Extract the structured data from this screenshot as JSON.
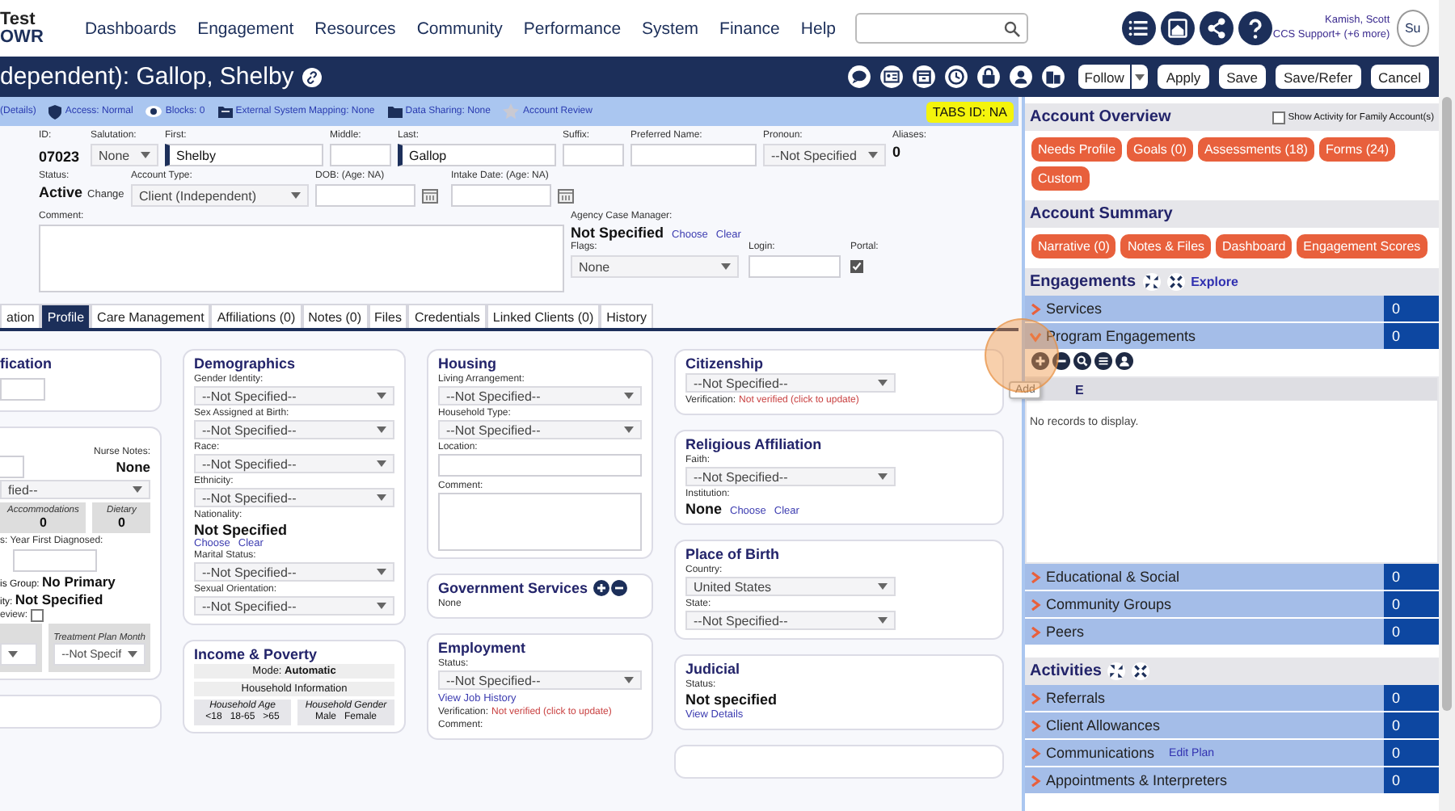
{
  "nav": {
    "logo_top": "Test",
    "logo_bottom": "OWR",
    "menu": [
      "Dashboards",
      "Engagement",
      "Resources",
      "Community",
      "Performance",
      "System",
      "Finance",
      "Help"
    ],
    "user": {
      "name": "Kamish, Scott",
      "role": "CCS Support+ (+6 more)",
      "avatar": "Su"
    }
  },
  "header": {
    "title": "dependent): Gallop, Shelby",
    "follow": "Follow",
    "buttons": [
      "Apply",
      "Save",
      "Save/Refer",
      "Cancel"
    ]
  },
  "info_bar": {
    "items": [
      "(Details)",
      "Access: Normal",
      "Blocks: 0",
      "External System Mapping: None",
      "Data Sharing: None",
      "Account Review"
    ],
    "tabs_id": "TABS ID: NA"
  },
  "client": {
    "id": {
      "label": "ID:",
      "value": "07023"
    },
    "salutation": {
      "label": "Salutation:",
      "value": "None"
    },
    "first": {
      "label": "First:",
      "value": "Shelby"
    },
    "middle": {
      "label": "Middle:"
    },
    "last": {
      "label": "Last:",
      "value": "Gallop"
    },
    "suffix": {
      "label": "Suffix:"
    },
    "preferred_name": {
      "label": "Preferred Name:"
    },
    "pronoun": {
      "label": "Pronoun:",
      "value": "--Not Specified"
    },
    "aliases": {
      "label": "Aliases:",
      "value": "0"
    },
    "status": {
      "label": "Status:",
      "value": "Active",
      "action": "Change"
    },
    "account_type": {
      "label": "Account Type:",
      "value": "Client (Independent)"
    },
    "dob": {
      "label": "DOB: (Age: NA)"
    },
    "intake_date": {
      "label": "Intake Date: (Age: NA)"
    },
    "comment": {
      "label": "Comment:"
    },
    "case_manager": {
      "label": "Agency Case Manager:",
      "value": "Not Specified",
      "links": [
        "Choose",
        "Clear"
      ]
    },
    "flags": {
      "label": "Flags:",
      "value": "None"
    },
    "login": {
      "label": "Login:"
    },
    "portal": {
      "label": "Portal:",
      "checked": true
    }
  },
  "tabs": [
    {
      "label": "ation",
      "selected": false
    },
    {
      "label": "Profile",
      "selected": true
    },
    {
      "label": "Care Management",
      "selected": false
    },
    {
      "label": "Affiliations (0)",
      "selected": false
    },
    {
      "label": "Notes (0)",
      "selected": false
    },
    {
      "label": "Files",
      "selected": false
    },
    {
      "label": "Credentials",
      "selected": false
    },
    {
      "label": "Linked Clients (0)",
      "selected": false
    },
    {
      "label": "History",
      "selected": false
    }
  ],
  "identification_card": {
    "title": "fication"
  },
  "health_card": {
    "nurse_label": "Nurse Notes:",
    "nurse_value": "None",
    "select": "fied--",
    "boxes": [
      {
        "title": "Accommodations",
        "value": "0"
      },
      {
        "title": "Dietary",
        "value": "0"
      }
    ],
    "diagnosed_label": "s:  Year First Diagnosed:",
    "group": "is Group: **No Primary**",
    "ethnicity": "ity: **Not Specified**",
    "review": {
      "label": "eview:",
      "checked": false
    },
    "plan": {
      "title": "Treatment Plan Month",
      "value": "--Not Specif"
    }
  },
  "columns": [
    [
      {
        "title": "Demographics",
        "rows": [
          {
            "kind": "label",
            "text": "Gender Identity:"
          },
          {
            "kind": "select",
            "value": "--Not Specified--"
          },
          {
            "kind": "label",
            "text": "Sex Assigned at Birth:"
          },
          {
            "kind": "select",
            "value": "--Not Specified--"
          },
          {
            "kind": "label",
            "text": "Race:"
          },
          {
            "kind": "select",
            "value": "--Not Specified--"
          },
          {
            "kind": "label",
            "text": "Ethnicity:"
          },
          {
            "kind": "select",
            "value": "--Not Specified--"
          },
          {
            "kind": "label",
            "text": "Nationality:"
          },
          {
            "kind": "value",
            "text": "Not Specified"
          },
          {
            "kind": "links",
            "items": [
              "Choose",
              "Clear"
            ]
          },
          {
            "kind": "label",
            "text": "Marital Status:"
          },
          {
            "kind": "select",
            "value": "--Not Specified--"
          },
          {
            "kind": "label",
            "text": "Sexual Orientation:"
          },
          {
            "kind": "select",
            "value": "--Not Specified--"
          }
        ]
      },
      {
        "title": "Income & Poverty",
        "rows": [
          {
            "kind": "band",
            "text": "Mode: **Automatic**"
          },
          {
            "kind": "band",
            "text": "Household Information"
          },
          {
            "kind": "household",
            "groups": [
              {
                "title": "Household Age",
                "cols": [
                  "<18",
                  "18-65",
                  ">65"
                ]
              },
              {
                "title": "Household Gender",
                "cols": [
                  "Male",
                  "Female"
                ]
              }
            ]
          }
        ]
      }
    ],
    [
      {
        "title": "Housing",
        "rows": [
          {
            "kind": "label",
            "text": "Living Arrangement:"
          },
          {
            "kind": "select",
            "value": "--Not Specified--"
          },
          {
            "kind": "label",
            "text": "Household Type:"
          },
          {
            "kind": "select",
            "value": "--Not Specified--"
          },
          {
            "kind": "label",
            "text": "Location:"
          },
          {
            "kind": "input"
          },
          {
            "kind": "label",
            "text": "Comment:"
          },
          {
            "kind": "textarea"
          }
        ]
      },
      {
        "title": "Government Services",
        "add_remove": true,
        "rows": [
          {
            "kind": "note",
            "text": "None"
          }
        ]
      },
      {
        "title": "Employment",
        "rows": [
          {
            "kind": "label",
            "text": "Status:"
          },
          {
            "kind": "select",
            "value": "--Not Specified--"
          },
          {
            "kind": "link",
            "text": "View Job History"
          },
          {
            "kind": "verification",
            "label": "Verification:",
            "text": "Not verified (click to update)"
          },
          {
            "kind": "label",
            "text": "Comment:"
          }
        ]
      }
    ],
    [
      {
        "title": "Citizenship",
        "rows": [
          {
            "kind": "select",
            "value": "--Not Specified--"
          },
          {
            "kind": "verification",
            "label": "Verification:",
            "text": "Not verified (click to update)"
          }
        ]
      },
      {
        "title": "Religious Affiliation",
        "rows": [
          {
            "kind": "label",
            "text": "Faith:"
          },
          {
            "kind": "select",
            "value": "--Not Specified--"
          },
          {
            "kind": "label",
            "text": "Institution:"
          },
          {
            "kind": "value_links",
            "text": "None",
            "items": [
              "Choose",
              "Clear"
            ]
          }
        ]
      },
      {
        "title": "Place of Birth",
        "rows": [
          {
            "kind": "label",
            "text": "Country:"
          },
          {
            "kind": "select",
            "value": "United States"
          },
          {
            "kind": "label",
            "text": "State:"
          },
          {
            "kind": "select",
            "value": "--Not Specified--"
          }
        ]
      },
      {
        "title": "Judicial",
        "rows": [
          {
            "kind": "label",
            "text": "Status:"
          },
          {
            "kind": "value",
            "text": "Not specified"
          },
          {
            "kind": "link",
            "text": "View Details"
          }
        ]
      }
    ]
  ],
  "account_overview": {
    "title": "Account Overview",
    "family": {
      "label": "Show Activity for Family Account(s)",
      "checked": false
    },
    "buttons": [
      "Needs Profile",
      "Goals (0)",
      "Assessments (18)",
      "Forms (24)",
      "Custom"
    ]
  },
  "account_summary": {
    "title": "Account Summary",
    "buttons": [
      "Narrative (0)",
      "Notes & Files",
      "Dashboard",
      "Engagement Scores"
    ]
  },
  "engagements": {
    "title": "Engagements",
    "explore": "Explore",
    "rows": [
      {
        "label": "Services",
        "count": "0",
        "expanded": false
      },
      {
        "label": "Program Engagements",
        "count": "0",
        "expanded": true,
        "grid": {
          "column": "E",
          "empty": "No records to display.",
          "tooltip": "Add"
        }
      },
      {
        "label": "Educational & Social",
        "count": "0",
        "expanded": false
      },
      {
        "label": "Community Groups",
        "count": "0",
        "expanded": false
      },
      {
        "label": "Peers",
        "count": "0",
        "expanded": false
      }
    ]
  },
  "activities": {
    "title": "Activities",
    "rows": [
      {
        "label": "Referrals",
        "count": "0",
        "expanded": false
      },
      {
        "label": "Client Allowances",
        "count": "0",
        "expanded": false
      },
      {
        "label": "Communications",
        "link": "Edit Plan",
        "count": "0",
        "expanded": false
      },
      {
        "label": "Appointments & Interpreters",
        "count": "0",
        "expanded": false
      }
    ]
  }
}
